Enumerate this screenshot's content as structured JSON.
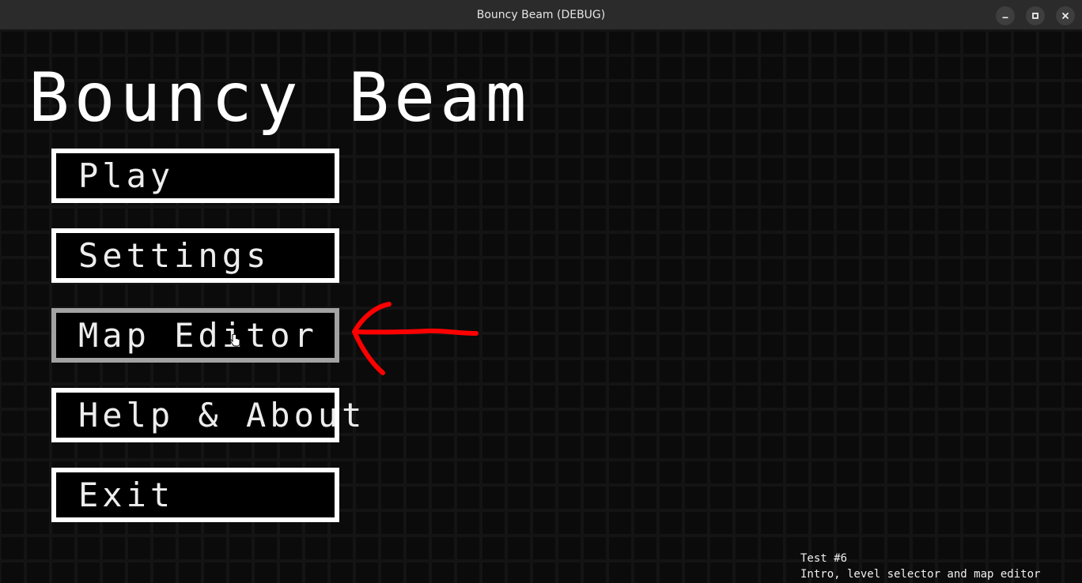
{
  "window": {
    "title": "Bouncy Beam (DEBUG)",
    "controls": [
      "minimize-icon",
      "maximize-icon",
      "close-icon"
    ]
  },
  "game": {
    "title": "Bouncy Beam",
    "menu": [
      {
        "label": "Play",
        "state": "normal"
      },
      {
        "label": "Settings",
        "state": "normal"
      },
      {
        "label": "Map Editor",
        "state": "hovered"
      },
      {
        "label": "Help & About",
        "state": "normal"
      },
      {
        "label": "Exit",
        "state": "normal"
      }
    ],
    "annotation": {
      "icon": "red-arrow-icon",
      "color": "#ff0000"
    },
    "info": {
      "line1": "Test #6",
      "line2": "Intro, level selector and map editor"
    }
  },
  "colors": {
    "background": "#0b0b0b",
    "grid": "#141414",
    "button_border": "#ffffff",
    "button_border_hover": "#a2a2a2",
    "titlebar": "#2b2b2b"
  }
}
